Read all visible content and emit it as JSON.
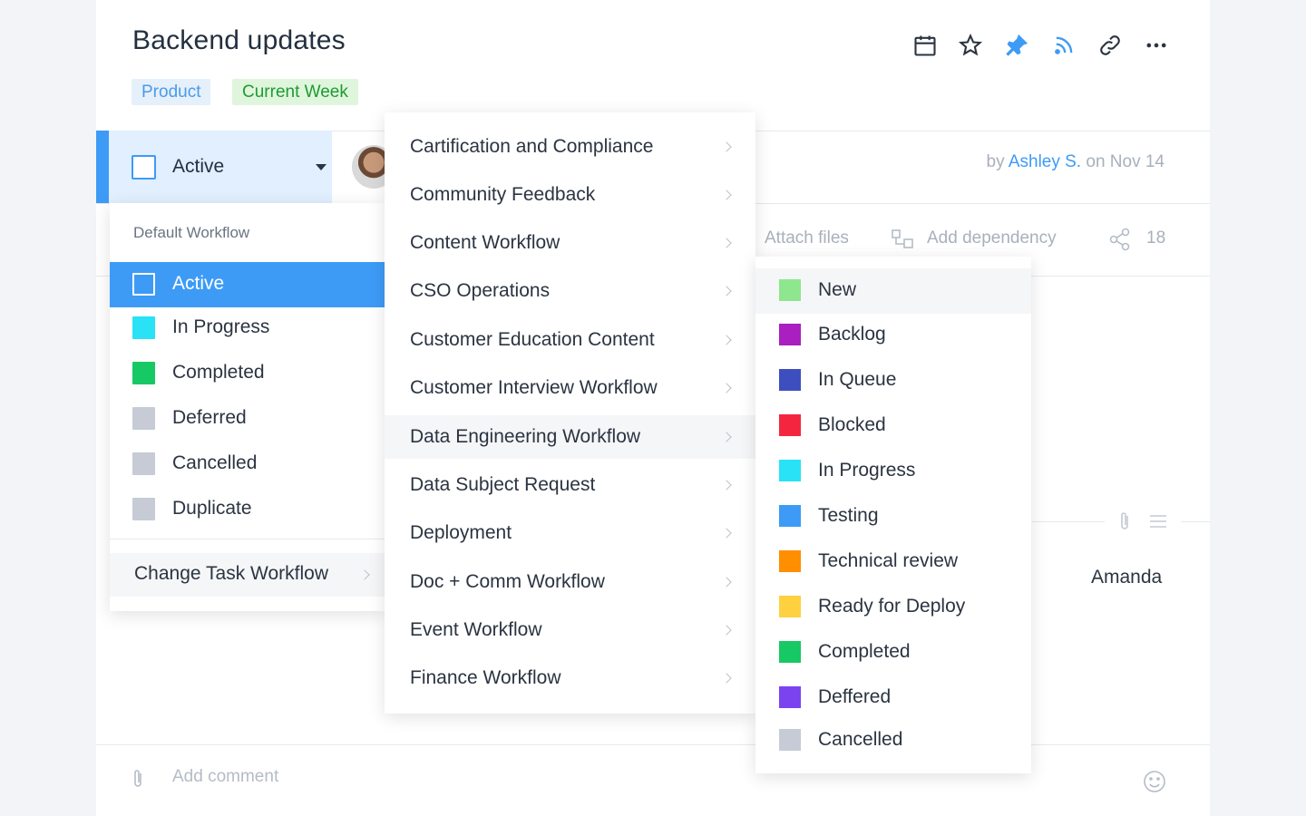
{
  "task": {
    "title": "Backend updates",
    "tags": [
      {
        "label": "Product"
      },
      {
        "label": "Current Week"
      }
    ],
    "status_label": "Active",
    "author_prefix": "by",
    "author_name": "Ashley S.",
    "author_suffix": "on Nov 14",
    "attach_files": "Attach files",
    "add_dependency": "Add dependency",
    "share_count": "18",
    "assignee": "Amanda",
    "comment_placeholder": "Add comment"
  },
  "toolbar": {
    "icons": [
      "calendar-icon",
      "star-icon",
      "pin-icon",
      "rss-icon",
      "link-icon",
      "more-icon"
    ],
    "accent": "#3d9bf6"
  },
  "status_menu": {
    "section": "Default Workflow",
    "items": [
      {
        "label": "Active",
        "color": "#3d9bf6",
        "selected": true
      },
      {
        "label": "In Progress",
        "color": "#29e2f5"
      },
      {
        "label": "Completed",
        "color": "#17c964"
      },
      {
        "label": "Deferred",
        "color": "#c6cbd6"
      },
      {
        "label": "Cancelled",
        "color": "#c6cbd6"
      },
      {
        "label": "Duplicate",
        "color": "#c6cbd6"
      }
    ],
    "change_workflow": "Change Task Workflow"
  },
  "workflows": [
    "Cartification and Compliance",
    "Community Feedback",
    "Content Workflow",
    "CSO Operations",
    "Customer Education Content",
    "Customer Interview Workflow",
    "Data Engineering Workflow",
    "Data Subject Request",
    "Deployment",
    "Doc + Comm Workflow",
    "Event Workflow",
    "Finance Workflow"
  ],
  "workflow_statuses": [
    {
      "label": "New",
      "color": "#8ee68f"
    },
    {
      "label": "Backlog",
      "color": "#a91fbf"
    },
    {
      "label": "In Queue",
      "color": "#3d4fbf"
    },
    {
      "label": "Blocked",
      "color": "#f4263f"
    },
    {
      "label": "In Progress",
      "color": "#29e2f5"
    },
    {
      "label": "Testing",
      "color": "#3d9bf6"
    },
    {
      "label": "Technical review",
      "color": "#ff8e00"
    },
    {
      "label": "Ready for Deploy",
      "color": "#ffd03f"
    },
    {
      "label": "Completed",
      "color": "#17c964"
    },
    {
      "label": "Deffered",
      "color": "#7a43f0"
    },
    {
      "label": "Cancelled",
      "color": "#c6cbd6"
    }
  ]
}
